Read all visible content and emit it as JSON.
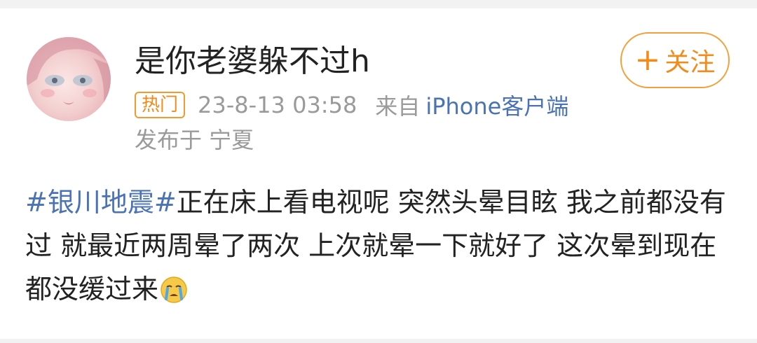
{
  "user": {
    "name": "是你老婆躲不过h",
    "avatar_icon": "anime-girl-avatar"
  },
  "follow_button": {
    "plus": "+",
    "label": "关注"
  },
  "meta": {
    "badge": "热门",
    "timestamp": "23-8-13 03:58",
    "from_label": "来自",
    "client": "iPhone客户端",
    "location": "发布于 宁夏"
  },
  "post": {
    "hashtag": "#银川地震#",
    "text": "正在床上看电视呢 突然头晕目眩 我之前都没有过 就最近两周晕了两次 上次就晕一下就好了 这次晕到现在都没缓过来",
    "emoji": "crying-face-emoji"
  },
  "colors": {
    "accent_orange": "#f28b1a",
    "link_blue": "#4a73b5",
    "text_gray": "#9a9a9a"
  }
}
